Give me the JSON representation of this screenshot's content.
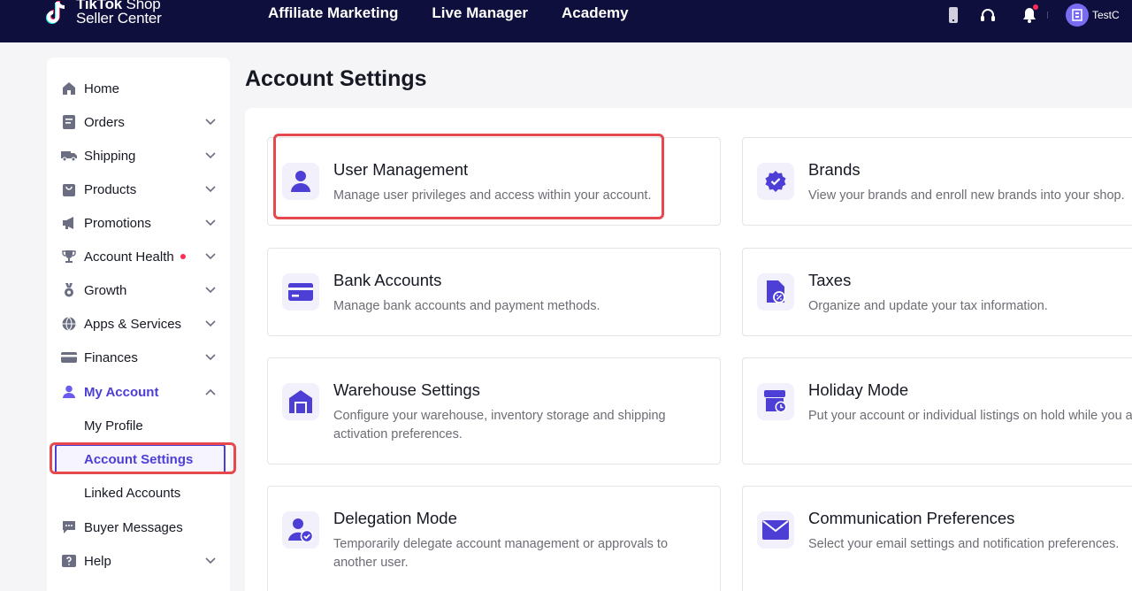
{
  "topnav": {
    "logo_line1_bold": "TikTok",
    "logo_line1_light": " Shop",
    "logo_line2": "Seller Center",
    "links": [
      "Affiliate Marketing",
      "Live Manager",
      "Academy"
    ],
    "user_name": "TestC"
  },
  "sidebar": {
    "items": [
      {
        "label": "Home",
        "icon": "home-icon"
      },
      {
        "label": "Orders",
        "icon": "orders-icon"
      },
      {
        "label": "Shipping",
        "icon": "truck-icon"
      },
      {
        "label": "Products",
        "icon": "bag-icon"
      },
      {
        "label": "Promotions",
        "icon": "megaphone-icon"
      },
      {
        "label": "Account Health",
        "icon": "trophy-icon"
      },
      {
        "label": "Growth",
        "icon": "medal-icon"
      },
      {
        "label": "Apps & Services",
        "icon": "globe-icon"
      },
      {
        "label": "Finances",
        "icon": "card-icon"
      },
      {
        "label": "My Account",
        "icon": "user-icon"
      },
      {
        "label": "Buyer Messages",
        "icon": "message-icon"
      },
      {
        "label": "Help",
        "icon": "help-icon"
      }
    ],
    "subitems": [
      "My Profile",
      "Account Settings",
      "Linked Accounts"
    ]
  },
  "main": {
    "title": "Account Settings",
    "cards": [
      {
        "title": "User Management",
        "desc": "Manage user privileges and access within your account.",
        "icon": "user-icon"
      },
      {
        "title": "Brands",
        "desc": "View your brands and enroll new brands into your shop.",
        "icon": "verified-badge-icon"
      },
      {
        "title": "Bank Accounts",
        "desc": "Manage bank accounts and payment methods.",
        "icon": "bank-card-icon"
      },
      {
        "title": "Taxes",
        "desc": "Organize and update your tax information.",
        "icon": "tax-document-icon"
      },
      {
        "title": "Warehouse Settings",
        "desc": "Configure your warehouse, inventory storage and shipping activation preferences.",
        "icon": "warehouse-icon"
      },
      {
        "title": "Holiday Mode",
        "desc": "Put your account or individual listings on hold while you a away.",
        "icon": "store-clock-icon"
      },
      {
        "title": "Delegation Mode",
        "desc": "Temporarily delegate account management or approvals to another user.",
        "icon": "user-check-icon"
      },
      {
        "title": "Communication Preferences",
        "desc": "Select your email settings and notification preferences.",
        "icon": "envelope-icon"
      }
    ]
  },
  "colors": {
    "nav_bg": "#0f0f3d",
    "accent": "#4d3fd6",
    "highlight_red": "#e5484d",
    "alert_dot": "#fe2c55"
  }
}
